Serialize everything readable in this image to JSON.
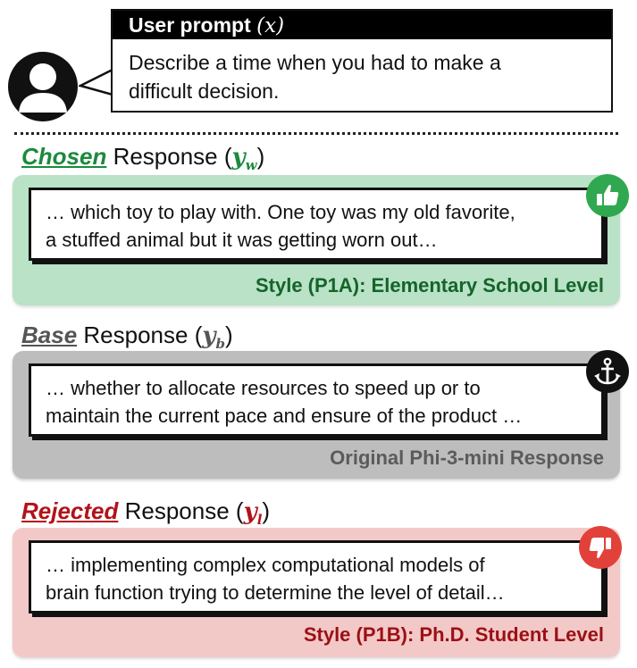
{
  "prompt": {
    "header_label": "User prompt",
    "header_var": "(x)",
    "text_line1": "Describe a time when you had to make a",
    "text_line2": "difficult decision."
  },
  "icons": [
    "user-avatar-icon",
    "thumbs-up-icon",
    "anchor-icon",
    "thumbs-down-icon"
  ],
  "chosen": {
    "keyword": "Chosen",
    "word": " Response ",
    "var_open": "(",
    "var_main": "y",
    "var_sub": "w",
    "var_close": ")",
    "line1": "… which toy to play with. One toy was my old favorite,",
    "line2": "a stuffed animal but it was getting worn out…",
    "style": "Style (P1A): Elementary School Level",
    "color": "#1b8a3c"
  },
  "base": {
    "keyword": "Base",
    "word": " Response ",
    "var_open": "(",
    "var_main": "y",
    "var_sub": "b",
    "var_close": ")",
    "line1": "… whether to allocate resources to speed up or to",
    "line2": "maintain the current pace and ensure of the product …",
    "style": "Original Phi-3-mini Response",
    "color": "#555555"
  },
  "rejected": {
    "keyword": "Rejected",
    "word": " Response ",
    "var_open": "(",
    "var_main": "y",
    "var_sub": "l",
    "var_close": ")",
    "line1": "… implementing complex computational models of",
    "line2": "brain function trying to determine the level of detail…",
    "style": "Style (P1B): Ph.D. Student Level",
    "color": "#b3121a"
  }
}
